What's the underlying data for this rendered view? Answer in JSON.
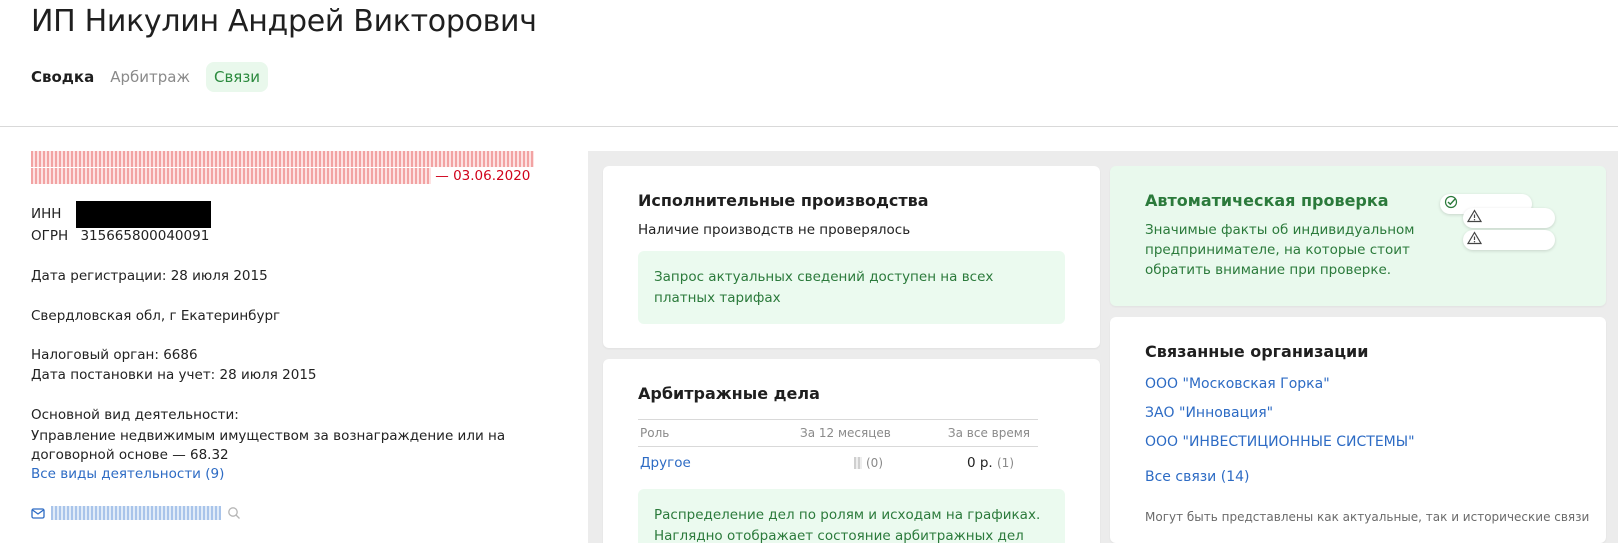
{
  "header": {
    "title": "ИП Никулин Андрей Викторович",
    "tabs": [
      {
        "label": "Сводка"
      },
      {
        "label": "Арбитраж"
      },
      {
        "label": "Связи"
      }
    ]
  },
  "summary": {
    "status_date": "— 03.06.2020",
    "inn_label": "ИНН",
    "ogrn_label": "ОГРН",
    "ogrn_value": "315665800040091",
    "registration_date": "Дата регистрации: 28 июля 2015",
    "region": "Свердловская обл, г Екатеринбург",
    "tax_authority": "Налоговый орган: 6686",
    "tax_registration_date": "Дата постановки на учет: 28 июля 2015",
    "activity_label": "Основной вид деятельности:",
    "activity_value": "Управление недвижимым имуществом за вознаграждение или на договорной основе — 68.32",
    "all_activities_link": "Все виды деятельности (9)",
    "icons": {
      "email": "mail-icon",
      "search": "search-icon"
    }
  },
  "enforcement": {
    "title": "Исполнительные производства",
    "status": "Наличие производств не проверялось",
    "notice": "Запрос актуальных сведений доступен на всех платных тарифах"
  },
  "arbitration": {
    "title": "Арбитражные дела",
    "columns": [
      "Роль",
      "За 12 месяцев",
      "За все время"
    ],
    "rows": [
      {
        "role": "Другое",
        "last12_count": "(0)",
        "total_value": "0 р.",
        "total_count": "(1)"
      }
    ],
    "notice": "Распределение дел по ролям и исходам на графиках. Наглядно отображает состояние арбитражных дел"
  },
  "auto_check": {
    "title": "Автоматическая проверка",
    "description": "Значимые факты об индивидуальном предпринимателе, на которые стоит обратить внимание при проверке.",
    "icons": [
      "check-circle-icon",
      "warning-icon",
      "warning-icon"
    ]
  },
  "related": {
    "title": "Связанные организации",
    "orgs": [
      "ООО \"Московская Горка\"",
      "ЗАО \"Инновация\"",
      "ООО \"ИНВЕСТИЦИОННЫЕ СИСТЕМЫ\""
    ],
    "all_link": "Все связи (14)",
    "note": "Могут быть представлены как актуальные, так и исторические связи"
  },
  "colors": {
    "accent_green": "#2b7a3b",
    "link_blue": "#2d6bc4",
    "alert_red": "#d0021b",
    "panel_green_bg": "#e9f9ed"
  }
}
